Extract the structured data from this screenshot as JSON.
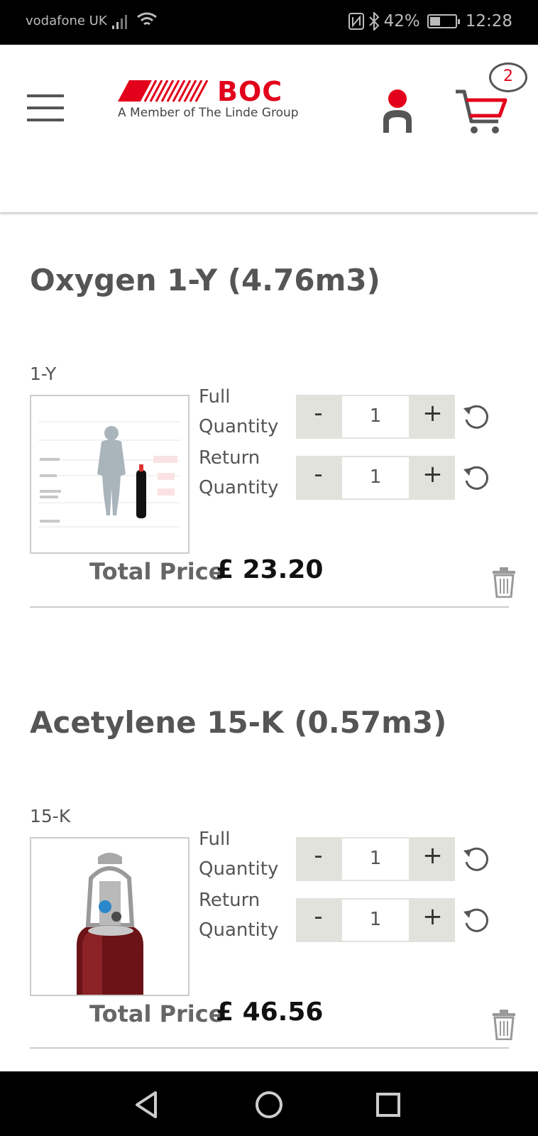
{
  "status_bar": {
    "carrier": "vodafone UK",
    "battery": "42%",
    "battery_level": 0.42,
    "time": "12:28",
    "icons": [
      "signal-icon",
      "wifi-icon",
      "nfc-icon",
      "bluetooth-icon",
      "battery-icon"
    ]
  },
  "header": {
    "logo_text": "BOC",
    "logo_tagline": "A Member of The Linde Group",
    "cart_count": "2",
    "icons": [
      "menu-icon",
      "user-icon",
      "cart-icon"
    ]
  },
  "colors": {
    "brand_red": "#e3001b",
    "text_gray": "#555555",
    "stepper_bg": "#e2e2dc"
  },
  "products": [
    {
      "title": "Oxygen 1-Y (4.76m3)",
      "code": "1-Y",
      "full_label": "Full Quantity",
      "full_qty": "1",
      "return_label": "Return Quantity",
      "return_qty": "1",
      "minus": "-",
      "plus": "+",
      "total_label": "Total Price",
      "total_value": "£ 23.20"
    },
    {
      "title": "Acetylene 15-K (0.57m3)",
      "code": "15-K",
      "full_label": "Full Quantity",
      "full_qty": "1",
      "return_label": "Return Quantity",
      "return_qty": "1",
      "minus": "-",
      "plus": "+",
      "total_label": "Total Price",
      "total_value": "£ 46.56"
    }
  ],
  "nav_bar": {
    "icons": [
      "back-icon",
      "home-icon",
      "recents-icon"
    ]
  }
}
